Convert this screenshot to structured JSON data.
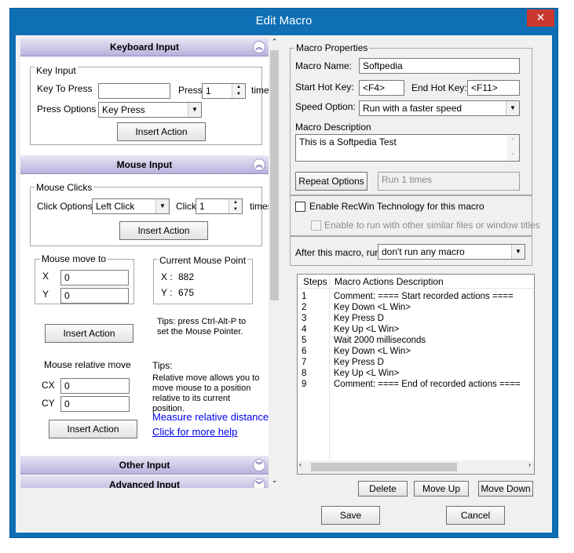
{
  "window": {
    "title": "Edit Macro",
    "close_glyph": "✕"
  },
  "keyboard": {
    "header": "Keyboard Input",
    "group_label": "Key Input",
    "key_to_press_label": "Key To Press",
    "key_to_press_value": "",
    "press_label": "Press",
    "press_count": "1",
    "times_label": "times",
    "press_options_label": "Press Options",
    "press_option_value": "Key Press",
    "insert_label": "Insert Action"
  },
  "mouse": {
    "header": "Mouse Input",
    "clicks_label": "Mouse Clicks",
    "click_options_label": "Click Options",
    "click_option_value": "Left Click",
    "click_label": "Click",
    "click_count": "1",
    "times_label": "times",
    "insert_label": "Insert Action",
    "move_to_label": "Mouse move to",
    "x_label": "X",
    "y_label": "Y",
    "x_value": "0",
    "y_value": "0",
    "current_point_label": "Current Mouse Point",
    "cur_x_label": "X :",
    "cur_x_value": "882",
    "cur_y_label": "Y :",
    "cur_y_value": "675",
    "insert2_label": "Insert Action",
    "tips_move": "Tips: press Ctrl-Alt-P to set the Mouse Pointer.",
    "relative_label": "Mouse relative move",
    "cx_label": "CX",
    "cy_label": "CY",
    "cx_value": "0",
    "cy_value": "0",
    "insert3_label": "Insert Action",
    "tips_title": "Tips:",
    "tips_relative": "Relative move allows you to move mouse to a position relative to its current position.",
    "measure_link": "Measure relative distance",
    "help_link": "Click for more help"
  },
  "other_header": "Other Input",
  "advanced_header": "Advanced Input",
  "props": {
    "group_label": "Macro Properties",
    "name_label": "Macro Name:",
    "name_value": "Softpedia",
    "start_label": "Start Hot Key:",
    "start_value": "<F4>",
    "end_label": "End Hot Key:",
    "end_value": "<F11>",
    "speed_label": "Speed Option:",
    "speed_value": "Run with a faster speed",
    "desc_label": "Macro Description",
    "desc_value": "This is a Softpedia Test",
    "repeat_label": "Repeat Options",
    "repeat_value": "Run 1 times"
  },
  "recwin": {
    "label": "Enable RecWin Technology for this macro",
    "sub_label": "Enable to run with other similar files or window titles"
  },
  "after": {
    "label": "After this macro, run",
    "value": "don't run any macro"
  },
  "table": {
    "col_steps": "Steps",
    "col_desc": "Macro Actions Description",
    "rows": [
      {
        "step": "1",
        "desc": "Comment: ==== Start recorded actions ===="
      },
      {
        "step": "2",
        "desc": "Key Down <L Win>"
      },
      {
        "step": "3",
        "desc": "Key Press D"
      },
      {
        "step": "4",
        "desc": "Key Up <L Win>"
      },
      {
        "step": "5",
        "desc": "Wait 2000 milliseconds"
      },
      {
        "step": "6",
        "desc": "Key Down <L Win>"
      },
      {
        "step": "7",
        "desc": "Key Press D"
      },
      {
        "step": "8",
        "desc": "Key Up <L Win>"
      },
      {
        "step": "9",
        "desc": "Comment: ==== End of recorded actions ===="
      }
    ]
  },
  "buttons": {
    "delete": "Delete",
    "move_up": "Move Up",
    "move_down": "Move Down",
    "save": "Save",
    "cancel": "Cancel"
  }
}
